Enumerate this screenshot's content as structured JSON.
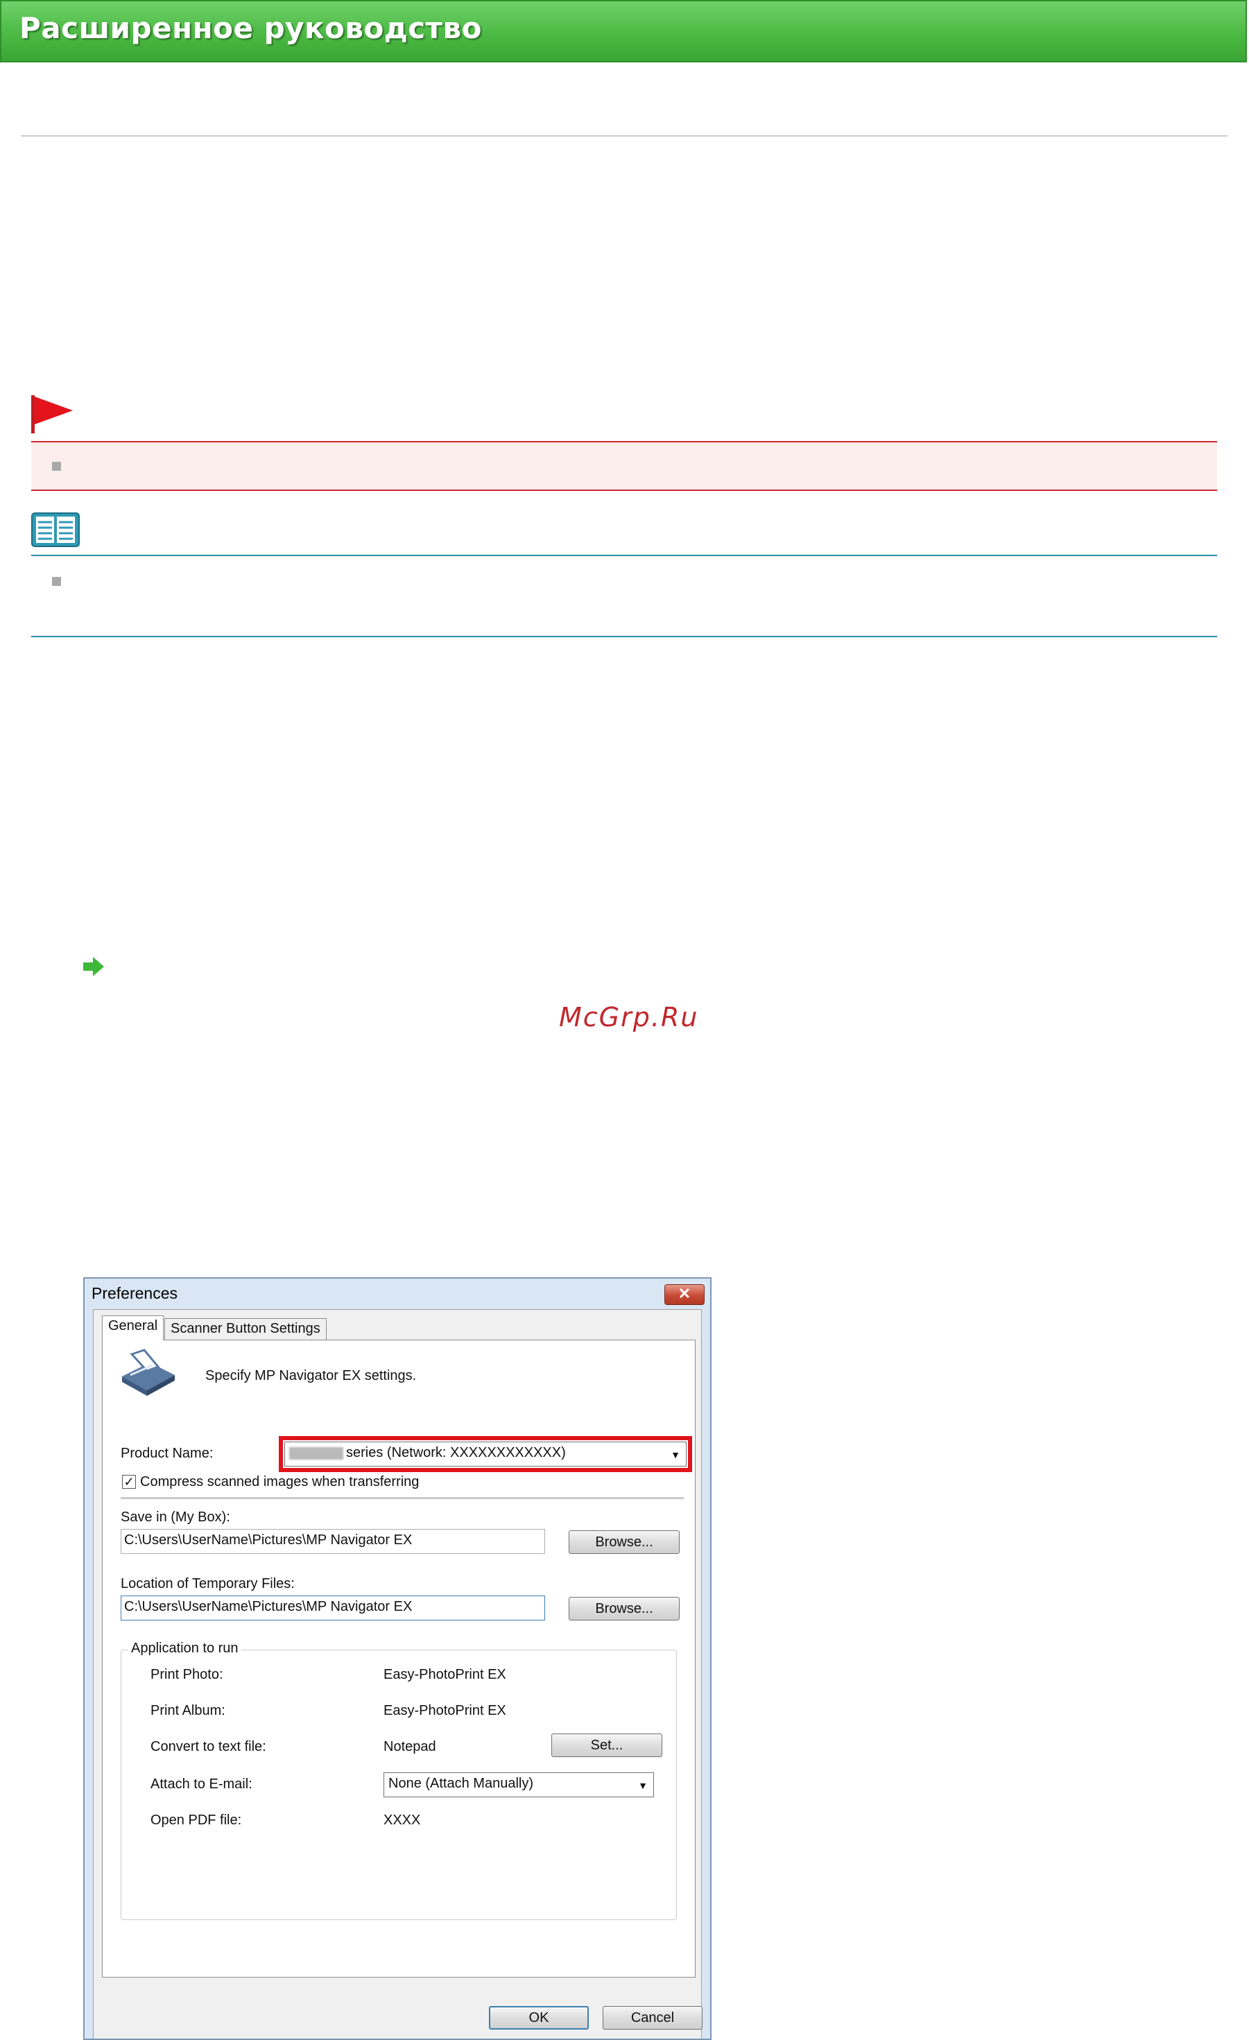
{
  "header": {
    "title": "Расширенное руководство"
  },
  "watermark": "McGrp.Ru",
  "dialog": {
    "title": "Preferences",
    "close_glyph": "✕",
    "tabs": [
      {
        "label": "General"
      },
      {
        "label": "Scanner Button Settings"
      }
    ],
    "description": "Specify MP Navigator EX settings.",
    "product_name_label": "Product Name:",
    "product_name_value": "series (Network: XXXXXXXXXXXX)",
    "compress_checkbox": {
      "label": "Compress scanned images when transferring",
      "checked": true,
      "mark": "✓"
    },
    "save_in_label": "Save in (My Box):",
    "save_in_value": "C:\\Users\\UserName\\Pictures\\MP Navigator EX",
    "browse_label": "Browse...",
    "temp_files_label": "Location of Temporary Files:",
    "temp_files_value": "C:\\Users\\UserName\\Pictures\\MP Navigator EX",
    "app_group_label": "Application to run",
    "apps": {
      "print_photo_label": "Print Photo:",
      "print_photo_value": "Easy-PhotoPrint EX",
      "print_album_label": "Print Album:",
      "print_album_value": "Easy-PhotoPrint EX",
      "convert_label": "Convert to text file:",
      "convert_value": "Notepad",
      "set_label": "Set...",
      "email_label": "Attach to E-mail:",
      "email_value": "None (Attach Manually)",
      "pdf_label": "Open PDF file:",
      "pdf_value": "XXXX"
    },
    "ok_label": "OK",
    "cancel_label": "Cancel"
  },
  "colors": {
    "header_green": "#4cba44",
    "caution_red": "#d0242c",
    "note_teal": "#2b8fa5",
    "highlight_red": "#e0141c"
  }
}
